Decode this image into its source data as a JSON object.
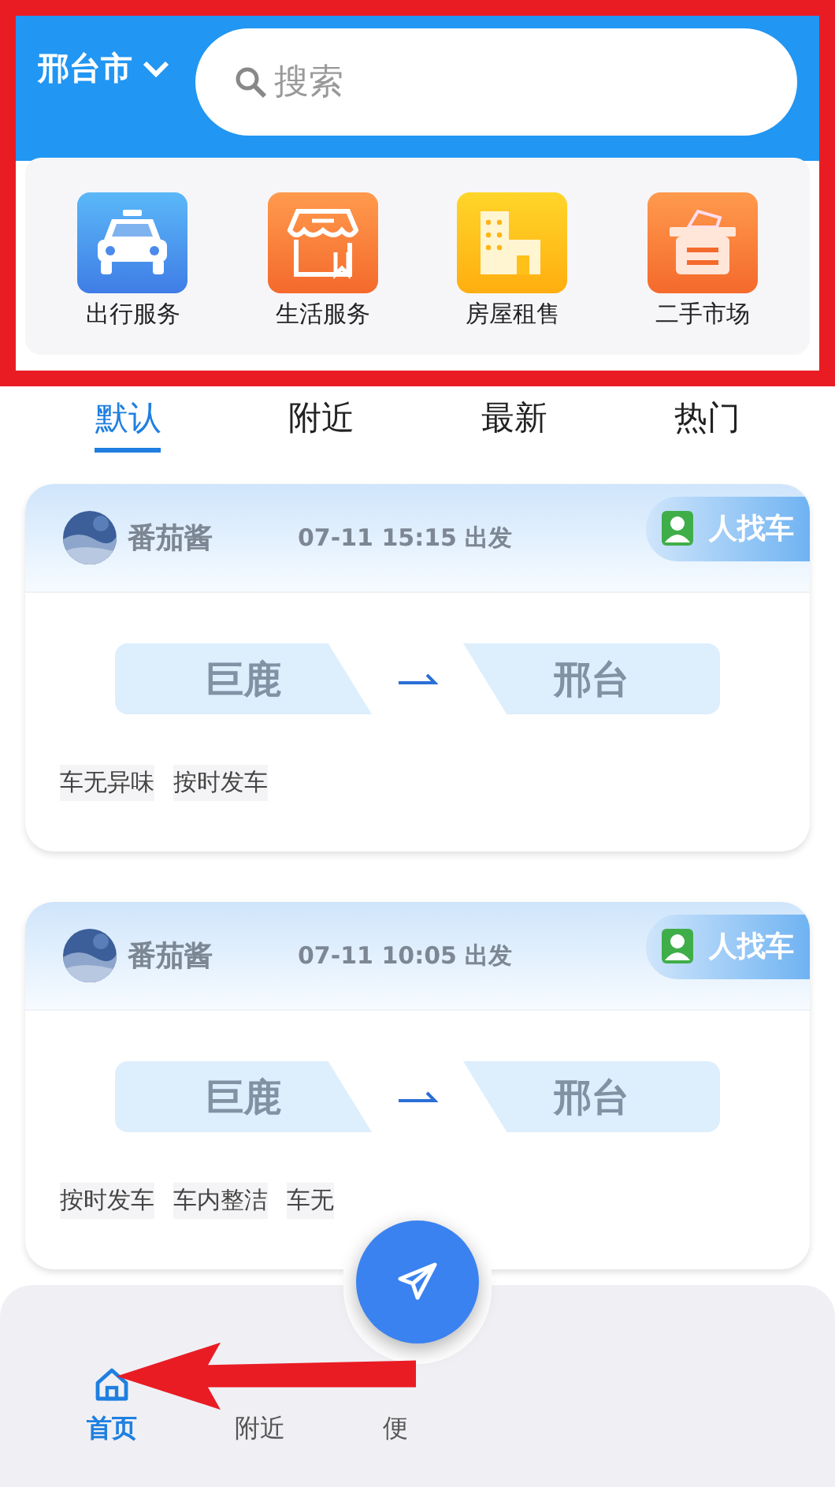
{
  "header": {
    "city": "邢台市",
    "search": {
      "placeholder": "搜索"
    }
  },
  "services": [
    {
      "label": "出行服务",
      "kind": "taxi"
    },
    {
      "label": "生活服务",
      "kind": "shop"
    },
    {
      "label": "房屋租售",
      "kind": "house"
    },
    {
      "label": "二手市场",
      "kind": "secondhand"
    }
  ],
  "tabs": [
    {
      "label": "默认",
      "selected": true
    },
    {
      "label": "附近",
      "selected": false
    },
    {
      "label": "最新",
      "selected": false
    },
    {
      "label": "热门",
      "selected": false
    }
  ],
  "posts": [
    {
      "user": "番茄酱",
      "time": "07-11 15:15 出发",
      "badge": "人找车",
      "from": "巨鹿",
      "to": "邢台",
      "tags": [
        "车无异味",
        "按时发车"
      ]
    },
    {
      "user": "番茄酱",
      "time": "07-11 10:05 出发",
      "badge": "人找车",
      "from": "巨鹿",
      "to": "邢台",
      "tags": [
        "按时发车",
        "车内整洁",
        "车无"
      ]
    }
  ],
  "bottom_nav": [
    {
      "label": "首页",
      "selected": true,
      "kind": "home"
    },
    {
      "label": "附近",
      "selected": false,
      "kind": "hidden"
    },
    {
      "label": "便",
      "selected": false,
      "kind": "hidden"
    }
  ]
}
